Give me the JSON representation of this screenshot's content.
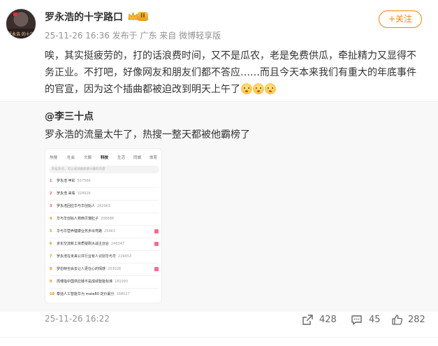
{
  "post": {
    "author": "罗永浩的十字路口",
    "vip_level": "II",
    "meta": "25-11-26 16:36  发布于 广东  来自 微博轻享版",
    "follow_label": "+关注",
    "avatar_caption": "罗永浩 的十字路口",
    "text": "唉，其实挺疲劳的，打的话浪费时间，又不是瓜农，老是免费供瓜，牵扯精力又显得不务正业。不打吧，好像网友和朋友们都不答应……而且今天本来我们有重大的年底事件的官宣，因为这个插曲都被迫改到明天上午了"
  },
  "repost": {
    "user": "@李三十点",
    "text": "罗永浩的流量太牛了，热搜一整天都被他霸榜了",
    "hot_list": {
      "tabs": [
        "热搜",
        "社会",
        "文娱",
        "科技",
        "生活",
        "同城",
        "体育"
      ],
      "active_tab": "科技",
      "search_placeholder": "科技热点，可以试试搜索感兴趣的内容",
      "items": [
        {
          "rank": "1",
          "title": "罗永浩 甲彩",
          "count": "557566"
        },
        {
          "rank": "2",
          "title": "罗永浩 来看",
          "count": "328926"
        },
        {
          "rank": "3",
          "title": "罗永浩回应华与华创始人",
          "count": "262963"
        },
        {
          "rank": "4",
          "title": "华与华创始人称西贝饿肚子",
          "count": "206688"
        },
        {
          "rank": "5",
          "title": "华与华营养健康业务步出弯路",
          "count": "25463"
        },
        {
          "rank": "6",
          "title": "京东交流新工资质疑刚大战主创合",
          "count": "249347"
        },
        {
          "rank": "7",
          "title": "罗永浩在未来公共行业有人识别华与华",
          "count": "229453"
        },
        {
          "rank": "8",
          "title": "罗伯特也会去让人更在心的情感",
          "count": "203028"
        },
        {
          "rank": "9",
          "title": "周博指中国供应链不是成绩智能标准",
          "count": "181093"
        },
        {
          "rank": "10",
          "title": "泰迪人工智能华为 mate80 定价最分",
          "count": "168027"
        }
      ]
    }
  },
  "footer": {
    "time": "25-11-26 16:22",
    "reposts": "428",
    "comments": "45",
    "likes": "282"
  },
  "colors": {
    "accent": "#ff8200",
    "meta_gray": "#939393",
    "repost_bg": "#f8f8f8",
    "hot_red": "#f25252"
  },
  "icons": [
    "repost-icon",
    "comment-icon",
    "like-icon",
    "crown-icon"
  ]
}
